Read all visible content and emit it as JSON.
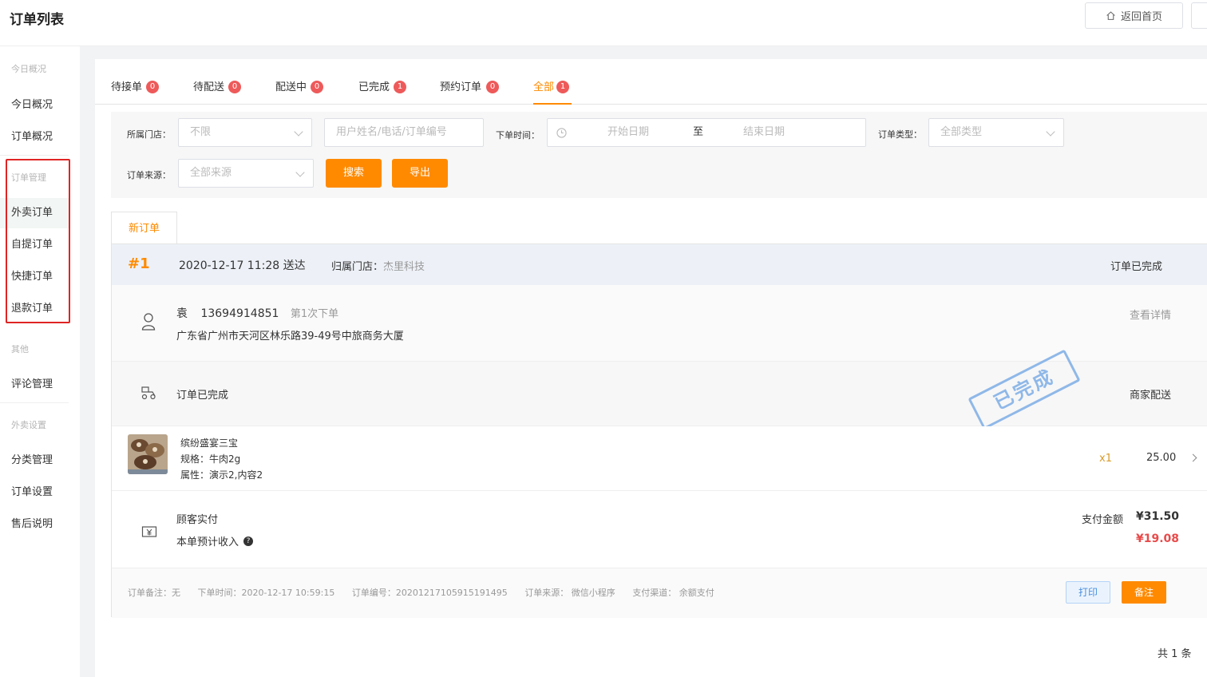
{
  "header": {
    "title": "订单列表",
    "home_button": "返回首页"
  },
  "sidebar": {
    "group_overview": "今日概况",
    "overview_items": [
      "今日概况",
      "订单概况"
    ],
    "group_orders": "订单管理",
    "order_items": [
      "外卖订单",
      "自提订单",
      "快捷订单",
      "退款订单"
    ],
    "group_other": "其他",
    "other_items": [
      "评论管理"
    ],
    "group_settings": "外卖设置",
    "settings_items": [
      "分类管理",
      "订单设置",
      "售后说明"
    ]
  },
  "tabs": [
    {
      "label": "待接单",
      "count": "0"
    },
    {
      "label": "待配送",
      "count": "0"
    },
    {
      "label": "配送中",
      "count": "0"
    },
    {
      "label": "已完成",
      "count": "1"
    },
    {
      "label": "预约订单",
      "count": "0"
    },
    {
      "label": "全部",
      "count": "1"
    }
  ],
  "filters": {
    "store_label": "所属门店：",
    "store_value": "不限",
    "search_placeholder": "用户姓名/电话/订单编号",
    "time_label": "下单时间：",
    "start_placeholder": "开始日期",
    "range_sep": "至",
    "end_placeholder": "结束日期",
    "type_label": "订单类型：",
    "type_value": "全部类型",
    "source_label": "订单来源：",
    "source_value": "全部来源",
    "search_button": "搜索",
    "export_button": "导出"
  },
  "list_tab": "新订单",
  "order": {
    "number": "#1",
    "time": "2020-12-17 11:28 送达",
    "store_label": "归属门店：",
    "store_name": "杰里科技",
    "status": "订单已完成",
    "customer_name": "袁",
    "customer_phone": "13694914851",
    "order_count": "第1次下单",
    "address": "广东省广州市天河区林乐路39-49号中旅商务大厦",
    "detail_link": "查看详情",
    "ship_status": "订单已完成",
    "ship_type": "商家配送",
    "stamp": "已完成",
    "item": {
      "name": "缤纷盛宴三宝",
      "spec": "规格：牛肉2g",
      "attr": "属性：演示2,内容2",
      "qty": "x1",
      "price": "25.00"
    },
    "pay_label": "顾客实付",
    "est_label": "本单预计收入",
    "pay_amount_label": "支付金额",
    "pay_amount": "¥31.50",
    "est_amount": "¥19.08",
    "footer": {
      "note": "订单备注：无",
      "order_time": "下单时间：2020-12-17 10:59:15",
      "order_no": "订单编号：20201217105915191495",
      "source": "订单来源： 微信小程序",
      "payment": "支付渠道： 余额支付"
    },
    "print_button": "打印",
    "note_button": "备注"
  },
  "pagination": {
    "total": "共 1 条"
  }
}
